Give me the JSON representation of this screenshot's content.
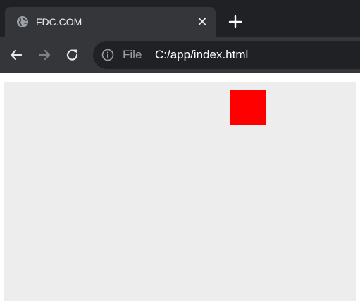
{
  "tab": {
    "title": "FDC.COM",
    "icon": "globe-icon",
    "close_icon": "close-icon"
  },
  "new_tab_icon": "plus-icon",
  "toolbar": {
    "back_icon": "arrow-left-icon",
    "forward_icon": "arrow-right-icon",
    "reload_icon": "reload-icon"
  },
  "address_bar": {
    "security_icon": "info-icon",
    "scheme_label": "File",
    "url": "C:/app/index.html"
  },
  "page": {
    "background": "#ededed",
    "box_color": "#ff0000"
  },
  "colors": {
    "chrome_dark": "#202124",
    "chrome_tab": "#35363a",
    "text": "#e8eaed",
    "muted": "#9aa0a6"
  }
}
